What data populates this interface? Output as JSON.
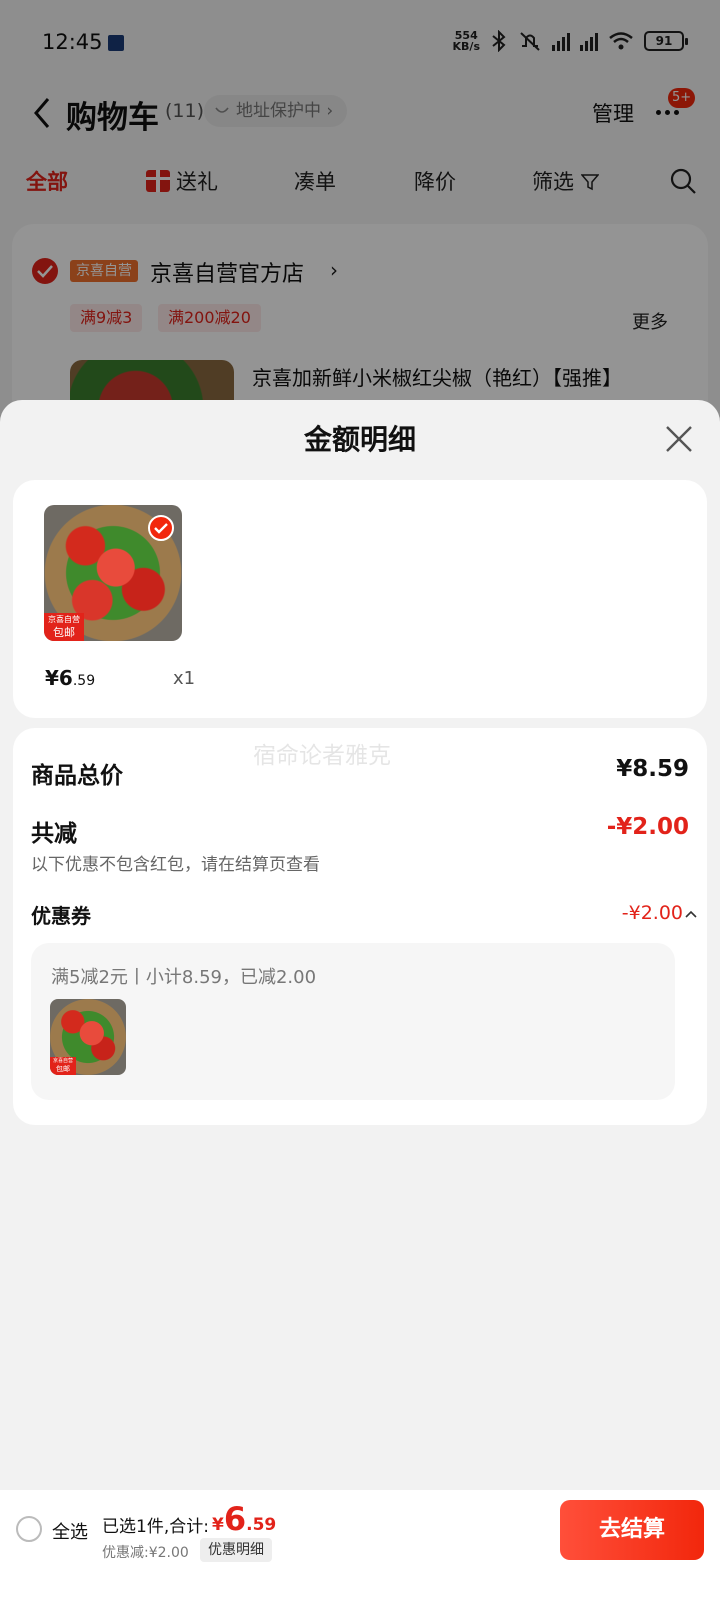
{
  "status_bar": {
    "time": "12:45",
    "net_speed_value": "554",
    "net_speed_unit": "KB/s",
    "battery": "91"
  },
  "nav": {
    "title": "购物车",
    "count": "(11)",
    "address_status": "地址保护中",
    "manage_label": "管理",
    "badge": "5+"
  },
  "tabs": [
    {
      "label": "全部"
    },
    {
      "label": "送礼"
    },
    {
      "label": "凑单"
    },
    {
      "label": "降价"
    },
    {
      "label": "筛选"
    }
  ],
  "store": {
    "self_tag": "京喜自营",
    "name": "京喜自营官方店",
    "promo_1": "满9减3",
    "promo_2": "满200减20",
    "more_label": "更多",
    "product_title": "京喜加新鲜小米椒红尖椒（艳红）【强推】"
  },
  "sheet": {
    "title": "金额明细",
    "item": {
      "badge_line1": "京喜自营",
      "badge_line2": "包邮",
      "price_int": "¥6",
      "price_dec": ".59",
      "qty": "x1"
    },
    "watermark": "宿命论者雅克",
    "total_label": "商品总价",
    "total_value": "¥8.59",
    "reduce_label": "共减",
    "reduce_value": "-¥2.00",
    "reduce_note": "以下优惠不包含红包，请在结算页查看",
    "coupon_label": "优惠券",
    "coupon_value": "-¥2.00",
    "coupon_desc": "满5减2元丨小计8.59，已减2.00"
  },
  "bottom_bar": {
    "select_all": "全选",
    "summary": "已选1件,合计:",
    "total_currency": "¥",
    "total_int": "6",
    "total_dec": ".59",
    "discount": "优惠减:¥2.00",
    "detail_link": "优惠明细",
    "checkout": "去结算"
  },
  "colors": {
    "accent": "#e2231a",
    "checkout_gradient_start": "#ff4f3a",
    "checkout_gradient_end": "#f2270c",
    "promo_bg": "#fde9e9",
    "self_tag_bg": "#f0712e"
  }
}
